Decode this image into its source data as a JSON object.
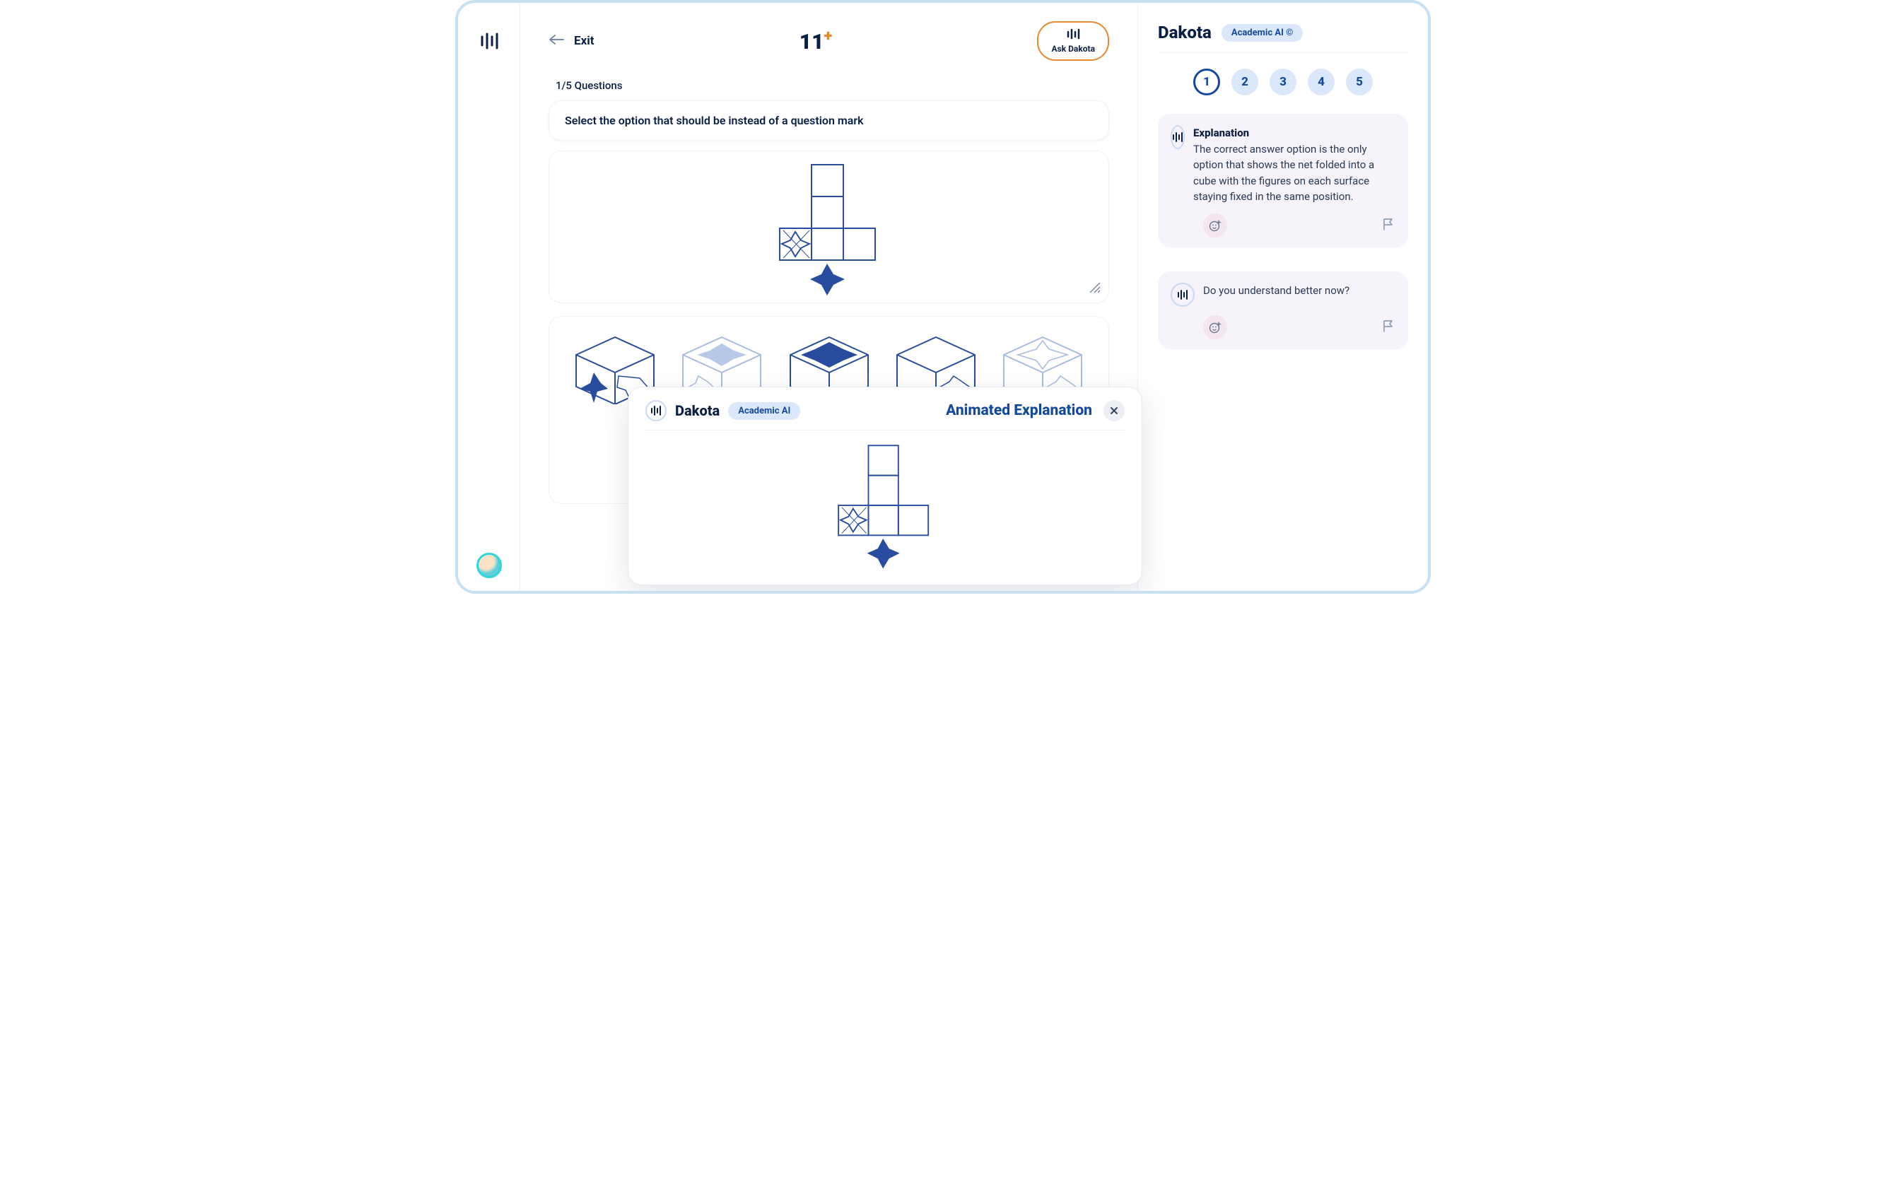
{
  "topbar": {
    "exit_label": "Exit",
    "logo_main": "11",
    "logo_plus": "+",
    "ask_label": "Ask Dakota"
  },
  "progress_text": "1/5 Questions",
  "prompt_text": "Select the option that should be instead of a question mark",
  "popup": {
    "name": "Dakota",
    "pill": "Academic AI",
    "title": "Animated Explanation"
  },
  "sidebar": {
    "name": "Dakota",
    "pill": "Academic AI ©",
    "nums": [
      "1",
      "2",
      "3",
      "4",
      "5"
    ],
    "active_index": 0,
    "msg1_title": "Explanation",
    "msg1_body": "The correct answer option is the only option that shows the net folded into a cube with the figures on each surface staying fixed in the same position.",
    "msg2_body": "Do you understand better now?"
  },
  "colors": {
    "navy": "#0a1f44",
    "blue": "#144a9c",
    "lightblue": "#dbe8fb",
    "orange": "#e6892e",
    "figure_blue": "#284d9e",
    "figure_lightfill": "#b7c9e6"
  }
}
